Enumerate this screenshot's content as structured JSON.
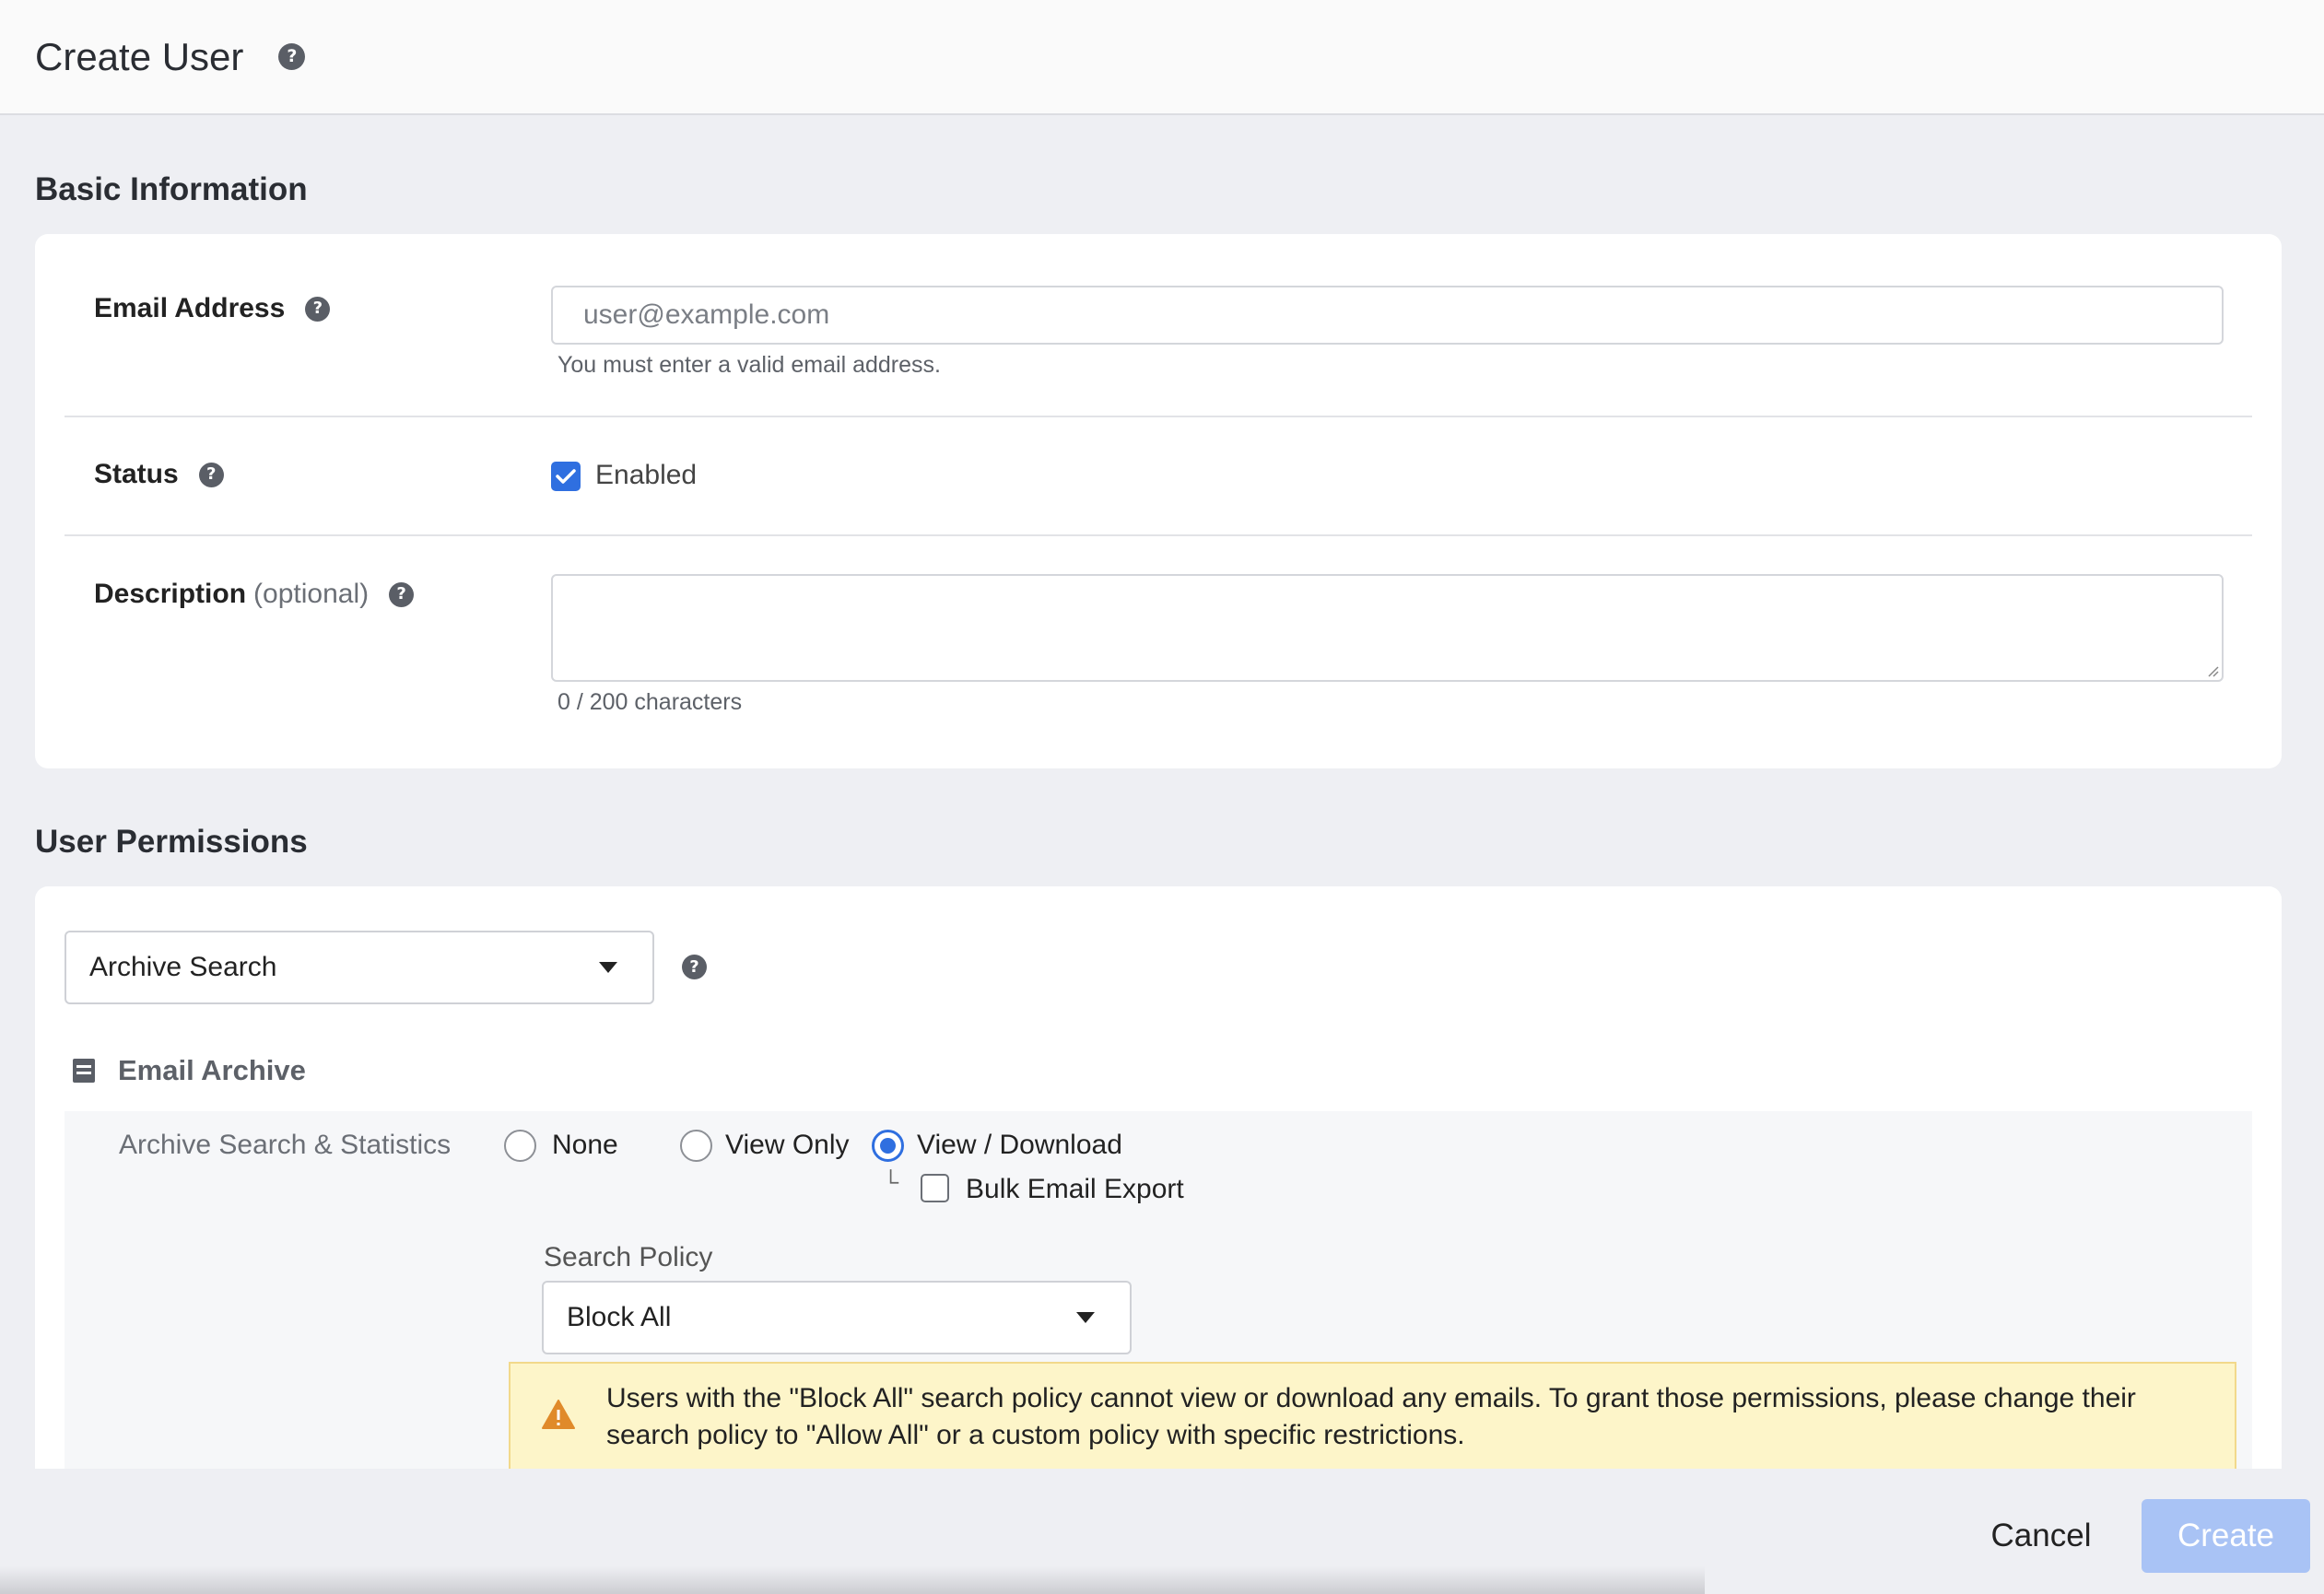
{
  "header": {
    "title": "Create User",
    "help_icon": "question-circle-icon"
  },
  "basic_information": {
    "section_title": "Basic Information",
    "email": {
      "label": "Email Address",
      "placeholder": "user@example.com",
      "value": "",
      "hint": "You must enter a valid email address."
    },
    "status": {
      "label": "Status",
      "checkbox_label": "Enabled",
      "checked": true
    },
    "description": {
      "label": "Description",
      "optional": "(optional)",
      "value": "",
      "counter": "0 / 200 characters"
    }
  },
  "user_permissions": {
    "section_title": "User Permissions",
    "category_select": {
      "value": "Archive Search"
    },
    "group": {
      "icon": "archive-box-icon",
      "title": "Email Archive",
      "row_label": "Archive Search & Statistics",
      "options": [
        "None",
        "View Only",
        "View / Download"
      ],
      "selected_option": "View / Download",
      "sub_option": {
        "prefix": "└",
        "label": "Bulk Email Export",
        "checked": false
      },
      "search_policy": {
        "label": "Search Policy",
        "value": "Block All"
      },
      "warning": {
        "icon": "warning-triangle-icon",
        "text": "Users with the \"Block All\" search policy cannot view or download any emails. To grant those permissions, please change their search policy to \"Allow All\" or a custom policy with specific restrictions."
      }
    }
  },
  "footer": {
    "cancel_label": "Cancel",
    "create_label": "Create"
  },
  "colors": {
    "accent": "#2f6fe0",
    "create_disabled": "#a9c3f5",
    "warning_bg": "#fdf5c9",
    "warning_icon": "#e08a2a"
  }
}
